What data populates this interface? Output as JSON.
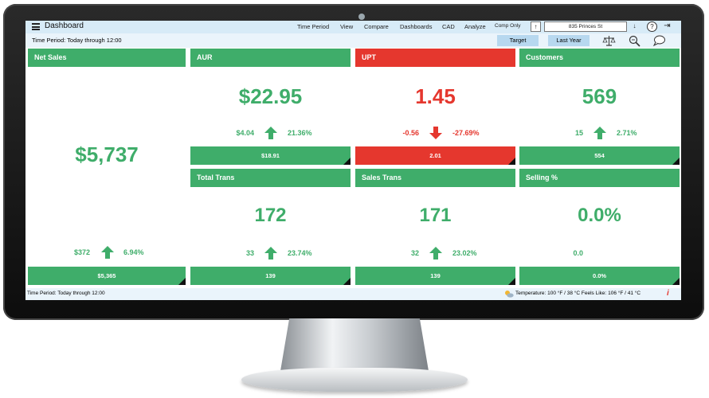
{
  "header": {
    "title": "Dashboard",
    "nav": [
      "Time Period",
      "View",
      "Compare",
      "Dashboards",
      "CAD",
      "Analyze"
    ],
    "comp_only": "Comp Only",
    "store": "835 Princes St"
  },
  "subbar": {
    "period": "Time Period: Today through 12:00",
    "target": "Target",
    "last_year": "Last Year"
  },
  "colors": {
    "green": "#3fad6a",
    "red": "#e5372e",
    "accent_light": "#d7ebf7"
  },
  "tiles": {
    "net_sales": {
      "title": "Net Sales",
      "value": "$5,737",
      "delta": "$372",
      "pct": "6.94%",
      "trend": "up",
      "footer": "$5,365"
    },
    "aur": {
      "title": "AUR",
      "value": "$22.95",
      "delta": "$4.04",
      "pct": "21.36%",
      "trend": "up",
      "footer": "$18.91"
    },
    "upt": {
      "title": "UPT",
      "value": "1.45",
      "delta": "-0.56",
      "pct": "-27.69%",
      "trend": "down",
      "footer": "2.01"
    },
    "customers": {
      "title": "Customers",
      "value": "569",
      "delta": "15",
      "pct": "2.71%",
      "trend": "up",
      "footer": "554"
    },
    "total_trans": {
      "title": "Total Trans",
      "value": "172",
      "delta": "33",
      "pct": "23.74%",
      "trend": "up",
      "footer": "139"
    },
    "sales_trans": {
      "title": "Sales Trans",
      "value": "171",
      "delta": "32",
      "pct": "23.02%",
      "trend": "up",
      "footer": "139"
    },
    "selling_pct": {
      "title": "Selling %",
      "value": "0.0%",
      "delta": "0.0",
      "pct": "",
      "trend": "none",
      "footer": "0.0%"
    }
  },
  "footer": {
    "period": "Time Period: Today through 12:00",
    "weather": "Temperature: 100 °F / 38 °C     Feels Like: 106 °F / 41 °C"
  }
}
